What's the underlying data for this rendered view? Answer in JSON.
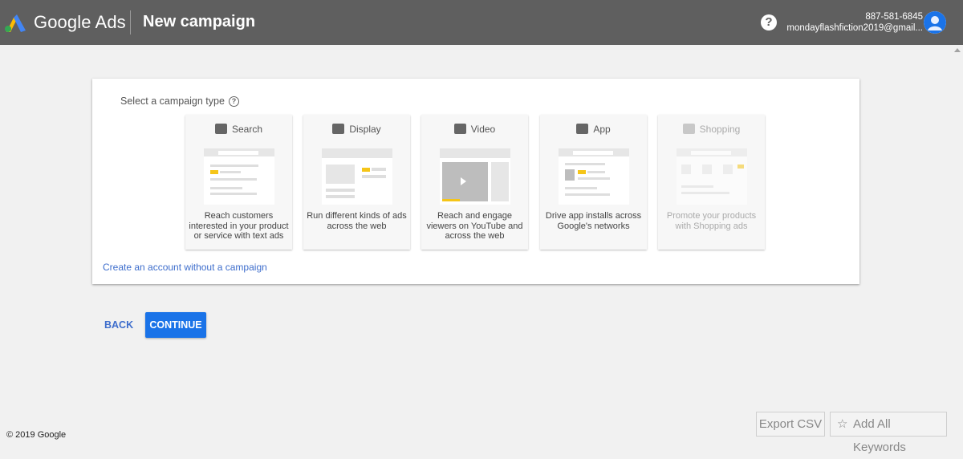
{
  "header": {
    "brand": "Google Ads",
    "page_title": "New campaign",
    "help_glyph": "?",
    "account_phone": "887-581-6845",
    "account_email": "mondayflashfiction2019@gmail..."
  },
  "campaign": {
    "prompt": "Select a campaign type",
    "types": [
      {
        "label": "Search",
        "icon": "search-icon",
        "desc": "Reach customers interested in your product or service with text ads",
        "enabled": true
      },
      {
        "label": "Display",
        "icon": "display-icon",
        "desc": "Run different kinds of ads across the web",
        "enabled": true
      },
      {
        "label": "Video",
        "icon": "video-icon",
        "desc": "Reach and engage viewers on YouTube and across the web",
        "enabled": true
      },
      {
        "label": "App",
        "icon": "app-icon",
        "desc": "Drive app installs across Google's networks",
        "enabled": true
      },
      {
        "label": "Shopping",
        "icon": "shopping-icon",
        "desc": "Promote your products with Shopping ads",
        "enabled": false
      }
    ],
    "create_link": "Create an account without a campaign"
  },
  "actions": {
    "back": "BACK",
    "continue": "CONTINUE"
  },
  "footer": {
    "copyright": "© 2019 Google",
    "export_csv": "Export CSV",
    "add_keywords": "Add All Keywords"
  },
  "colors": {
    "header_bg": "#5f5f5f",
    "primary": "#1a73e8",
    "link": "#3d6dcc",
    "accent_yellow": "#f5c518"
  }
}
